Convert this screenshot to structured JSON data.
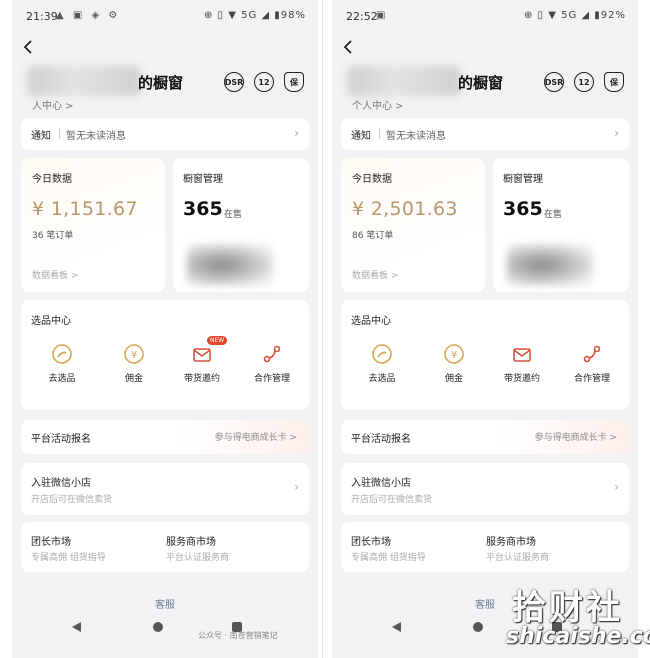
{
  "screens": [
    {
      "status": {
        "time": "21:39",
        "left_icons": "▲ ▣ ◈ ⚙",
        "right": "⊕ ▯ ▼ 5G ◢ ▮98%"
      },
      "header": {
        "shop_title": "的橱窗",
        "sub_link": "人中心 >"
      },
      "notice": {
        "label": "通知",
        "text": "暂无未读消息"
      },
      "today": {
        "title": "今日数据",
        "amount": "¥ 1,151.67",
        "orders": "36 笔订单",
        "link": "数据看板 >"
      },
      "window": {
        "title": "橱窗管理",
        "count": "365",
        "unit": "在售"
      },
      "select": {
        "title": "选品中心",
        "items": [
          "去选品",
          "佣金",
          "带货邀约",
          "合作管理"
        ],
        "badge": "NEW"
      },
      "activity": {
        "label": "平台活动报名",
        "right": "参与得电商成长卡 >"
      },
      "wechat": {
        "title": "入驻微信小店",
        "sub": "开店后可在微信卖货"
      },
      "markets": {
        "left_title": "团长市场",
        "left_sub": "专属高佣 组货指导",
        "right_title": "服务商市场",
        "right_sub": "平台认证服务商"
      },
      "service": "客服",
      "watermark": "公众号 · 南苍营销笔记"
    },
    {
      "status": {
        "time": "22:52",
        "left_icons": "▣",
        "right": "⊕ ▯ ▼ 5G ◢ ▮92%"
      },
      "header": {
        "shop_title": "的橱窗",
        "sub_link": "个人中心 >"
      },
      "notice": {
        "label": "通知",
        "text": "暂无未读消息"
      },
      "today": {
        "title": "今日数据",
        "amount": "¥ 2,501.63",
        "orders": "86 笔订单",
        "link": "数据看板 >"
      },
      "window": {
        "title": "橱窗管理",
        "count": "365",
        "unit": "在售"
      },
      "select": {
        "title": "选品中心",
        "items": [
          "去选品",
          "佣金",
          "带货邀约",
          "合作管理"
        ]
      },
      "activity": {
        "label": "平台活动报名",
        "right": "参与得电商成长卡 >"
      },
      "wechat": {
        "title": "入驻微信小店",
        "sub": "开店后可在微信卖货"
      },
      "markets": {
        "left_title": "团长市场",
        "left_sub": "专属高佣 组货指导",
        "right_title": "服务商市场",
        "right_sub": "平台认证服务商"
      },
      "service": "客服"
    }
  ],
  "header_icons": [
    "DSR",
    "12",
    "保"
  ],
  "site_watermark": {
    "name": "拾财社",
    "domain": "shicaishe.com"
  },
  "colors": {
    "amount": "#b8976a",
    "icon_gold": "#d4a94e",
    "icon_red": "#d4533f",
    "badge": "#e0452f",
    "service_link": "#6b7b98"
  }
}
